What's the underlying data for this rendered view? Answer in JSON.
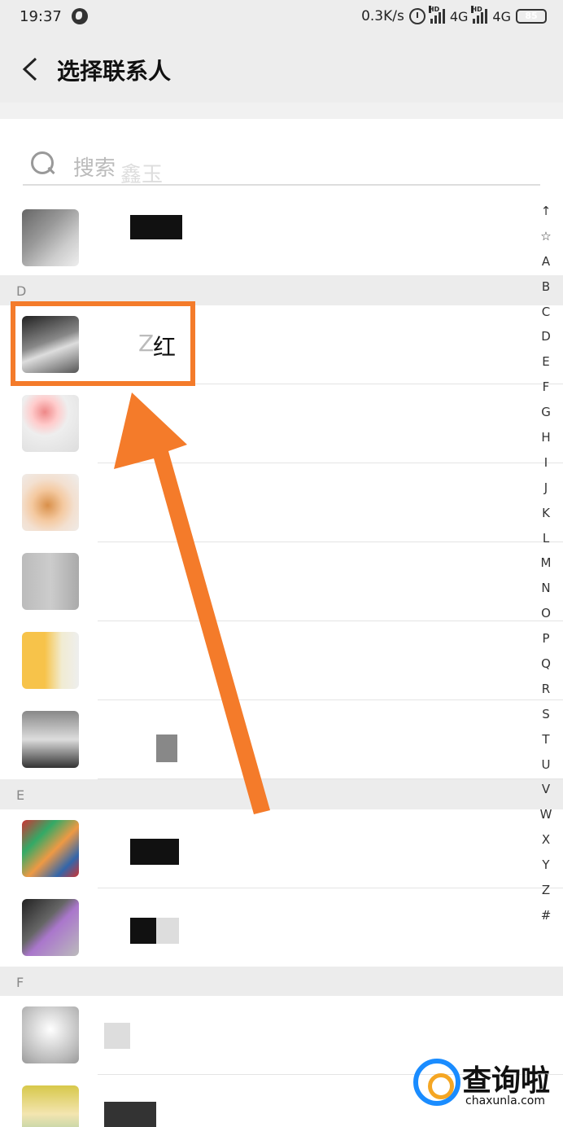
{
  "status_bar": {
    "time": "19:37",
    "net_speed": "0.3K/s",
    "network_1": "4G",
    "network_2": "4G",
    "hd_label": "HD",
    "battery": "85"
  },
  "header": {
    "title": "选择联系人"
  },
  "search": {
    "placeholder": "搜索",
    "ghost_text": "鑫玉"
  },
  "sections": {
    "d": "D",
    "e": "E",
    "f": "F"
  },
  "contacts": {
    "highlighted_name": "红",
    "highlighted_partial": "Z"
  },
  "az_index": [
    "↑",
    "☆",
    "A",
    "B",
    "C",
    "D",
    "E",
    "F",
    "G",
    "H",
    "I",
    "J",
    "K",
    "L",
    "M",
    "N",
    "O",
    "P",
    "Q",
    "R",
    "S",
    "T",
    "U",
    "V",
    "W",
    "X",
    "Y",
    "Z",
    "#"
  ],
  "watermark": {
    "brand": "查询啦",
    "domain": "chaxunla.com"
  },
  "colors": {
    "highlight": "#f47b2a",
    "battery": "#8a4bd8"
  }
}
